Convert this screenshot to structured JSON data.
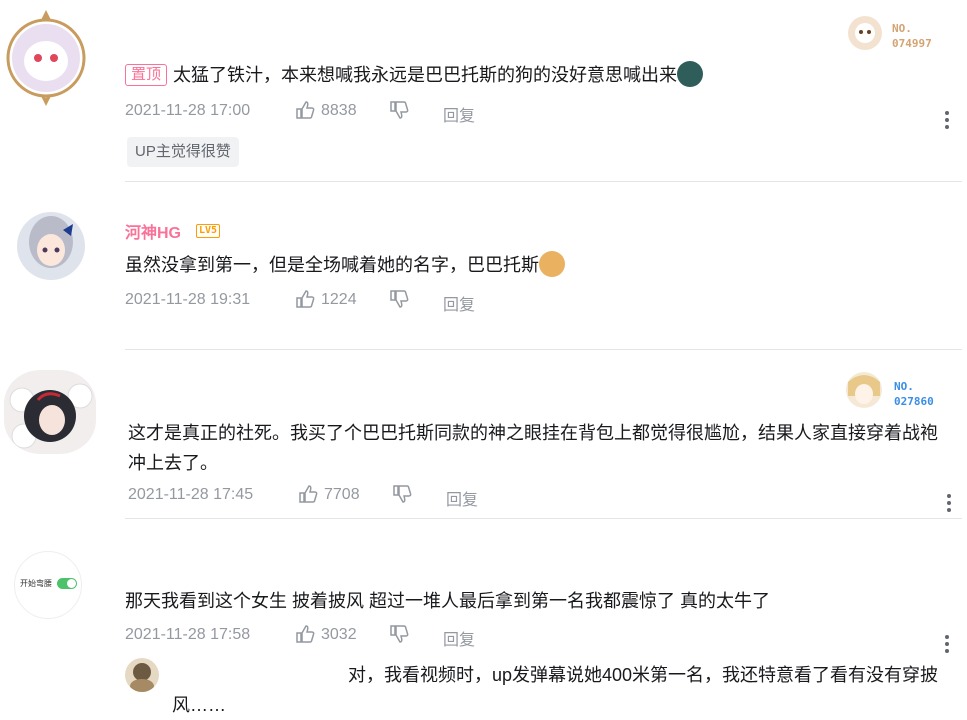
{
  "comments": [
    {
      "pinned_label": "置顶",
      "text": "太猛了铁汁，本来想喊我永远是巴巴托斯的狗的没好意思喊出来",
      "time": "2021-11-28 17:00",
      "likes": "8838",
      "reply_label": "回复",
      "up_liked": "UP主觉得很赞",
      "badge_no": "NO.",
      "badge_num": "074997"
    },
    {
      "username": "河神HG",
      "level": "LV5",
      "text": "虽然没拿到第一，但是全场喊着她的名字，巴巴托斯",
      "time": "2021-11-28 19:31",
      "likes": "1224",
      "reply_label": "回复"
    },
    {
      "text": "这才是真正的社死。我买了个巴巴托斯同款的神之眼挂在背包上都觉得很尴尬，结果人家直接穿着战袍冲上去了。",
      "time": "2021-11-28 17:45",
      "likes": "7708",
      "reply_label": "回复",
      "badge_no": "NO.",
      "badge_num": "027860"
    },
    {
      "avatar_text": "开始弯腰",
      "text": "那天我看到这个女生 披着披风 超过一堆人最后拿到第一名我都震惊了 真的太牛了",
      "time": "2021-11-28 17:58",
      "likes": "3032",
      "reply_label": "回复",
      "reply_preview": "对，我看视频时，up发弹幕说她400米第一名，我还特意看了看有没有穿披风……"
    }
  ],
  "colors": {
    "pink": "#fb7299",
    "gray": "#9499a0",
    "badge_orange": "#d4a373",
    "badge_blue": "#3a8ee6"
  }
}
